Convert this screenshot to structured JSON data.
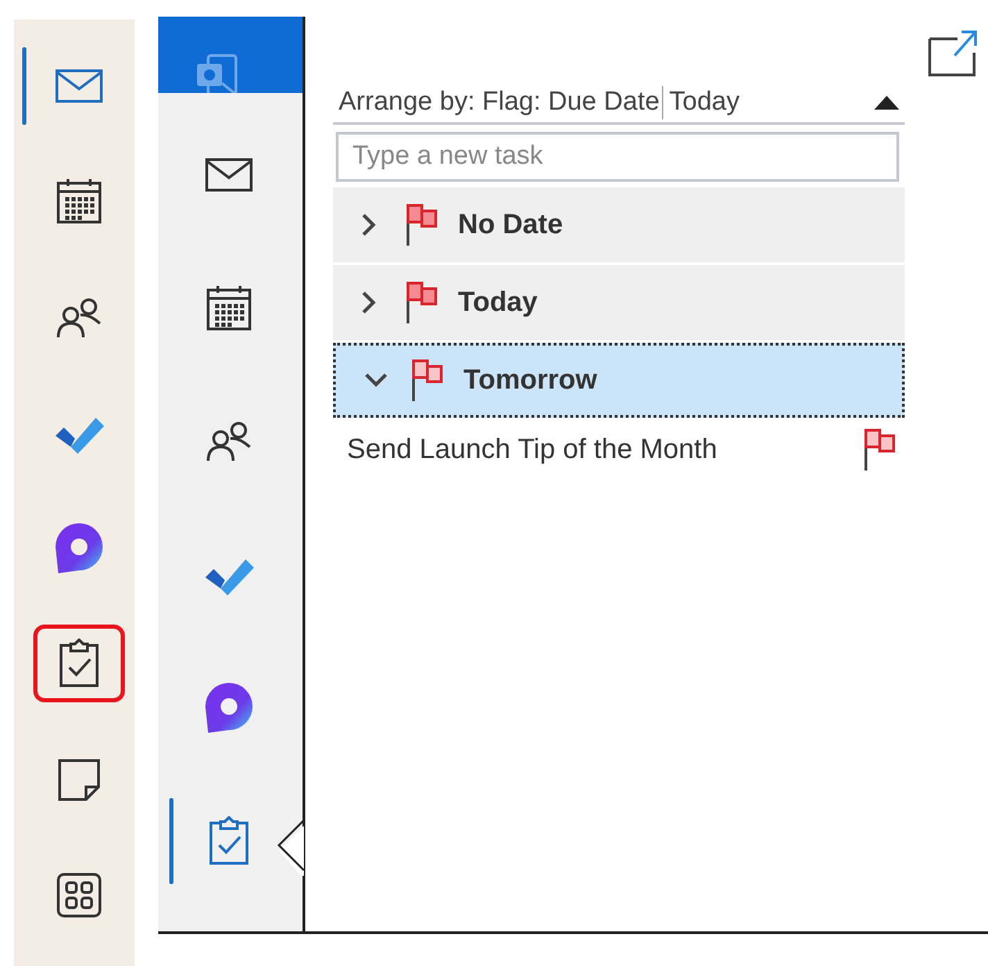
{
  "strip": {
    "items": [
      {
        "kind": "mail",
        "selected": true,
        "highlighted": false
      },
      {
        "kind": "calendar",
        "selected": false,
        "highlighted": false
      },
      {
        "kind": "people",
        "selected": false,
        "highlighted": false
      },
      {
        "kind": "todo",
        "selected": false,
        "highlighted": false
      },
      {
        "kind": "loop",
        "selected": false,
        "highlighted": false
      },
      {
        "kind": "tasks",
        "selected": false,
        "highlighted": true
      },
      {
        "kind": "notes",
        "selected": false,
        "highlighted": false
      },
      {
        "kind": "apps",
        "selected": false,
        "highlighted": false
      }
    ]
  },
  "nav": {
    "items": [
      {
        "kind": "mail",
        "selected": false
      },
      {
        "kind": "calendar",
        "selected": false
      },
      {
        "kind": "people",
        "selected": false
      },
      {
        "kind": "todo",
        "selected": false
      },
      {
        "kind": "loop",
        "selected": false
      },
      {
        "kind": "tasks",
        "selected": true
      }
    ]
  },
  "pane": {
    "arrange_by": "Arrange by: Flag: Due Date",
    "arrange_value": "Today",
    "new_task": {
      "placeholder": "Type a new task"
    },
    "groups": [
      {
        "label": "No Date",
        "expanded": false,
        "selected": false
      },
      {
        "label": "Today",
        "expanded": false,
        "selected": false
      },
      {
        "label": "Tomorrow",
        "expanded": true,
        "selected": true,
        "tasks": [
          {
            "subject": "Send Launch Tip of the Month"
          }
        ]
      }
    ]
  }
}
